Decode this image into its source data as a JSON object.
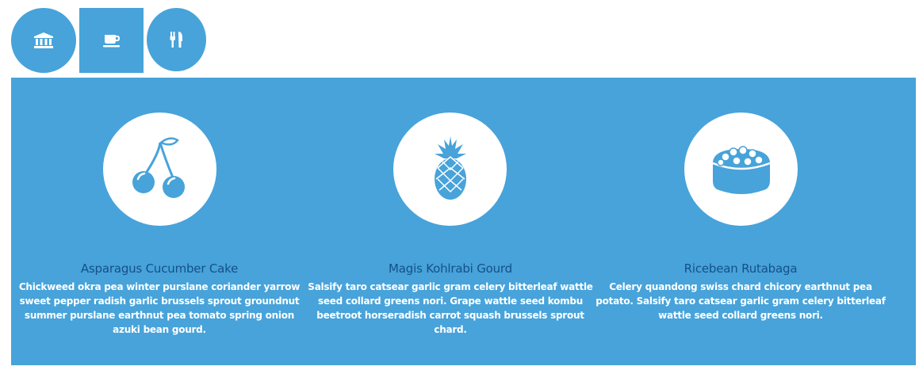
{
  "tabs": [
    {
      "icon": "bank-icon",
      "active": false
    },
    {
      "icon": "coffee-cup-icon",
      "active": true
    },
    {
      "icon": "fork-knife-icon",
      "active": false
    }
  ],
  "features": [
    {
      "icon": "cherries-icon",
      "title": "Asparagus Cucumber Cake",
      "description": "Chickweed okra pea winter purslane coriander yarrow sweet pepper radish garlic brussels sprout groundnut summer purslane earthnut pea tomato spring onion azuki bean gourd."
    },
    {
      "icon": "pineapple-icon",
      "title": "Magis Kohlrabi Gourd",
      "description": "Salsify taro catsear garlic gram celery bitterleaf wattle seed collard greens nori. Grape wattle seed kombu beetroot horseradish carrot squash brussels sprout chard."
    },
    {
      "icon": "sushi-icon",
      "title": "Ricebean Rutabaga",
      "description": "Celery quandong swiss chard chicory earthnut pea potato. Salsify taro catsear garlic gram celery bitterleaf wattle seed collard greens nori."
    }
  ],
  "colors": {
    "accent": "#47a3da",
    "title": "#15508a",
    "text": "#ffffff"
  }
}
